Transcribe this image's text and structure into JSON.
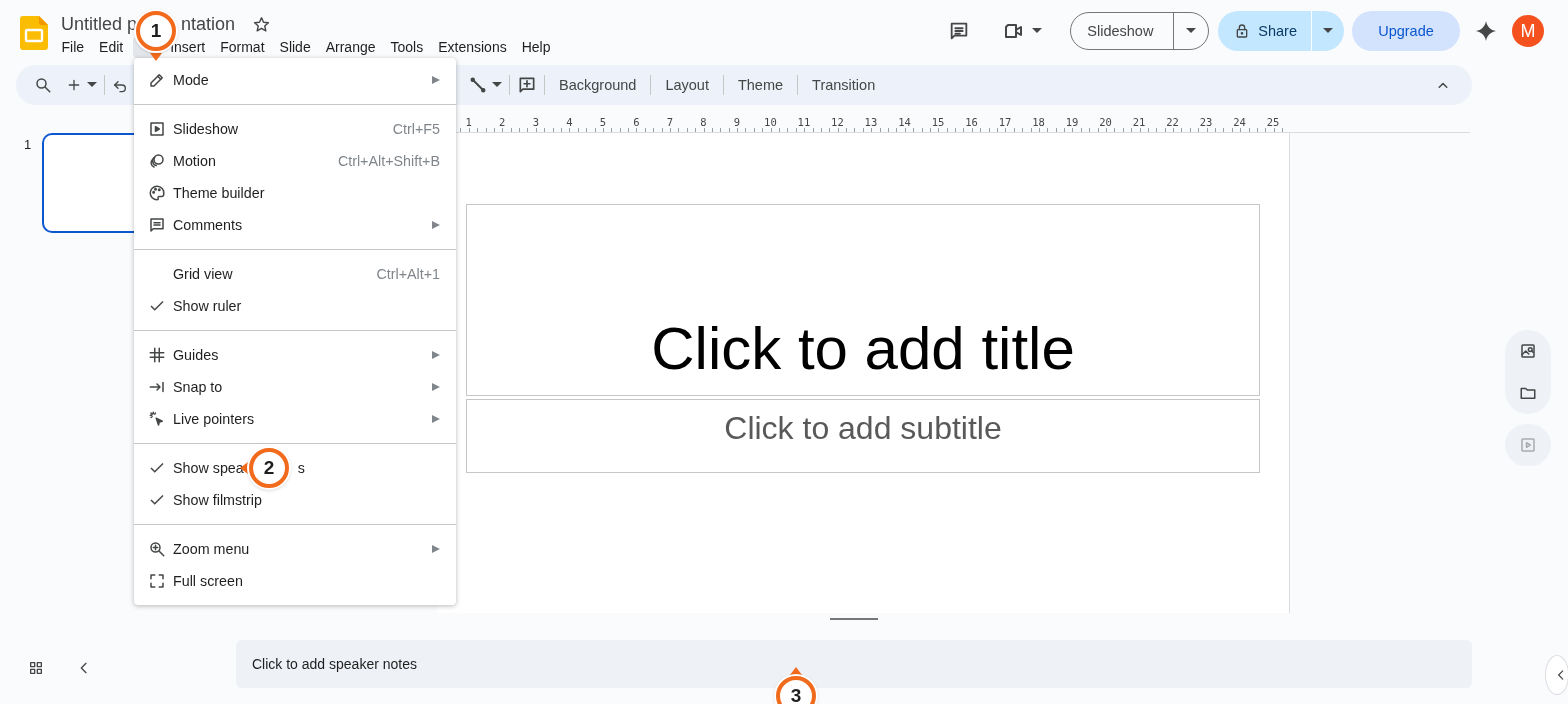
{
  "header": {
    "title_parts": [
      "Untitled p",
      "ntation"
    ],
    "starred": false,
    "menubar": [
      {
        "label": "File",
        "selected": false
      },
      {
        "label": "Edit",
        "selected": false
      },
      {
        "selected": true
      },
      {
        "label": "Insert",
        "selected": false
      },
      {
        "label": "Format",
        "selected": false
      },
      {
        "label": "Slide",
        "selected": false
      },
      {
        "label": "Arrange",
        "selected": false
      },
      {
        "label": "Tools",
        "selected": false
      },
      {
        "label": "Extensions",
        "selected": false
      },
      {
        "label": "Help",
        "selected": false
      }
    ],
    "slideshow_button": "Slideshow",
    "share_button": "Share",
    "upgrade_button": "Upgrade",
    "avatar": "M"
  },
  "toolbar": {
    "labels": [
      "Background",
      "Layout",
      "Theme",
      "Transition"
    ]
  },
  "view_menu": {
    "sections": [
      [
        {
          "kind": "command",
          "label": "Mode",
          "submenu": true
        }
      ],
      [
        {
          "kind": "command",
          "label": "Slideshow",
          "shortcut": "Ctrl+F5",
          "submenu": false
        },
        {
          "kind": "command",
          "label": "Motion",
          "shortcut": "Ctrl+Alt+Shift+B",
          "submenu": false
        },
        {
          "kind": "command",
          "label": "Theme builder",
          "submenu": false
        },
        {
          "kind": "command",
          "label": "Comments",
          "submenu": true
        }
      ],
      [
        {
          "kind": "toggle",
          "label": "Grid view",
          "shortcut": "Ctrl+Alt+1",
          "checked": false,
          "submenu": false
        },
        {
          "kind": "toggle",
          "label": "Show ruler",
          "checked": true,
          "submenu": false
        }
      ],
      [
        {
          "kind": "command",
          "label": "Guides",
          "submenu": true
        },
        {
          "kind": "command",
          "label": "Snap to",
          "submenu": true
        },
        {
          "kind": "command",
          "label": "Live pointers",
          "submenu": true
        }
      ],
      [
        {
          "kind": "toggle",
          "label_parts": [
            "Show spea",
            "s"
          ],
          "checked": true,
          "submenu": false
        },
        {
          "kind": "toggle",
          "label": "Show filmstrip",
          "checked": true,
          "submenu": false
        }
      ],
      [
        {
          "kind": "command",
          "label": "Zoom menu",
          "submenu": true
        },
        {
          "kind": "command",
          "label": "Full screen",
          "submenu": false
        }
      ]
    ]
  },
  "filmstrip": {
    "slides": [
      {
        "number": "1",
        "selected": true
      }
    ]
  },
  "ruler": {
    "labels": [
      "1",
      "2",
      "3",
      "4",
      "5",
      "6",
      "7",
      "8",
      "9",
      "10",
      "11",
      "12",
      "13",
      "14",
      "15",
      "16",
      "17",
      "18",
      "19",
      "20",
      "21",
      "22",
      "23",
      "24",
      "25"
    ]
  },
  "slide": {
    "title_placeholder": "Click to add title",
    "subtitle_placeholder": "Click to add subtitle"
  },
  "notes": {
    "placeholder": "Click to add speaker notes"
  },
  "callouts": [
    {
      "number": "1"
    },
    {
      "number": "2"
    },
    {
      "number": "3"
    }
  ]
}
